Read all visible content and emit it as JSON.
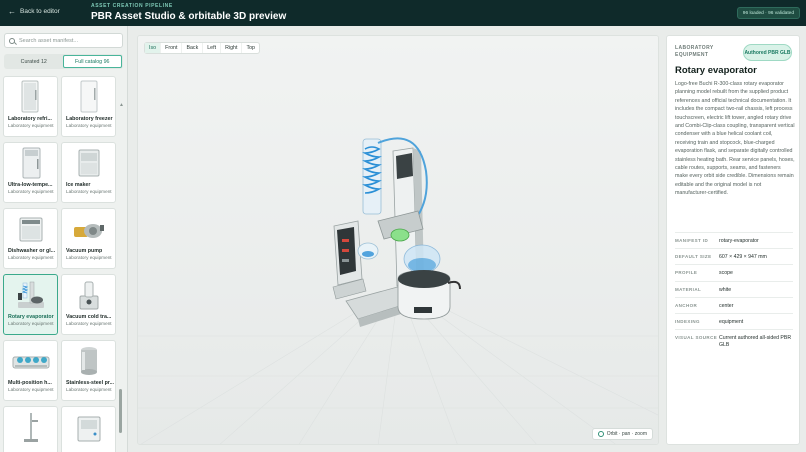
{
  "header": {
    "back_label": "Back to editor",
    "eyebrow": "ASSET CREATION PIPELINE",
    "title": "PBR Asset Studio & orbitable 3D preview",
    "status_badge": "96 loaded · 96 validated"
  },
  "sidebar": {
    "search_placeholder": "Search asset manifest...",
    "tabs": [
      {
        "label": "Curated 12",
        "active": false
      },
      {
        "label": "Full catalog 96",
        "active": true
      }
    ],
    "cards": [
      {
        "name": "Laboratory refri...",
        "category": "Laboratory equipment",
        "icon": "fridge-icon",
        "selected": false
      },
      {
        "name": "Laboratory freezer",
        "category": "Laboratory equipment",
        "icon": "freezer-icon",
        "selected": false
      },
      {
        "name": "Ultra-low-tempe...",
        "category": "Laboratory equipment",
        "icon": "ult-freezer-icon",
        "selected": false
      },
      {
        "name": "Ice maker",
        "category": "Laboratory equipment",
        "icon": "ice-maker-icon",
        "selected": false
      },
      {
        "name": "Dishwasher or gl...",
        "category": "Laboratory equipment",
        "icon": "dishwasher-icon",
        "selected": false
      },
      {
        "name": "Vacuum pump",
        "category": "Laboratory equipment",
        "icon": "vacuum-pump-icon",
        "selected": false
      },
      {
        "name": "Rotary evaporator",
        "category": "Laboratory equipment",
        "icon": "rotary-evaporator-icon",
        "selected": true
      },
      {
        "name": "Vacuum cold tra...",
        "category": "Laboratory equipment",
        "icon": "cold-trap-icon",
        "selected": false
      },
      {
        "name": "Multi-position h...",
        "category": "Laboratory equipment",
        "icon": "hotplate-icon",
        "selected": false
      },
      {
        "name": "Stainless-steel pr...",
        "category": "Laboratory equipment",
        "icon": "pressure-vessel-icon",
        "selected": false
      },
      {
        "name": "",
        "category": "",
        "icon": "stand-icon",
        "selected": false
      },
      {
        "name": "",
        "category": "",
        "icon": "cabinet-icon",
        "selected": false
      }
    ]
  },
  "viewport": {
    "views": [
      {
        "label": "Iso",
        "active": true
      },
      {
        "label": "Front",
        "active": false
      },
      {
        "label": "Back",
        "active": false
      },
      {
        "label": "Left",
        "active": false
      },
      {
        "label": "Right",
        "active": false
      },
      {
        "label": "Top",
        "active": false
      }
    ],
    "orbit_hint": "Orbit · pan · zoom"
  },
  "panel": {
    "category": "LABORATORY EQUIPMENT",
    "badge": "Authored PBR GLB",
    "name": "Rotary evaporator",
    "description": "Logo-free Buchi R-300-class rotary evaporator planning model rebuilt from the supplied product references and official technical documentation. It includes the compact two-rail chassis, left process touchscreen, electric lift tower, angled rotary drive and Combi-Clip-class coupling, transparent vertical condenser with a blue helical coolant coil, receiving train and stopcock, blue-charged evaporation flask, and separate digitally controlled stainless heating bath. Rear service panels, hoses, cable routes, supports, seams, and fasteners make every orbit side credible. Dimensions remain editable and the original model is not manufacturer-certified.",
    "properties": [
      {
        "key": "MANIFEST ID",
        "value": "rotary-evaporator"
      },
      {
        "key": "DEFAULT SIZE",
        "value": "607 × 429 × 947 mm"
      },
      {
        "key": "PROFILE",
        "value": "scope"
      },
      {
        "key": "MATERIAL",
        "value": "white"
      },
      {
        "key": "ANCHOR",
        "value": "center"
      },
      {
        "key": "INDEXING",
        "value": "equipment"
      },
      {
        "key": "VISUAL SOURCE",
        "value": "Current authored all-sided PBR GLB"
      }
    ]
  },
  "colors": {
    "header_bg": "#0f2a2a",
    "accent": "#2f9e80",
    "coil_blue": "#2a8fd6"
  }
}
